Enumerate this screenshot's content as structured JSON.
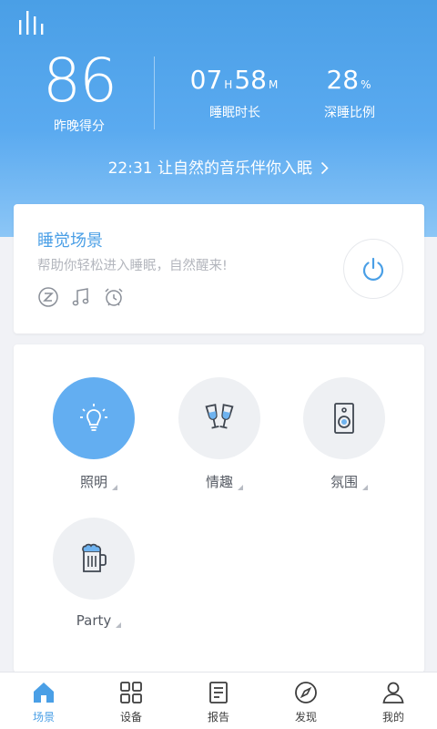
{
  "header": {
    "score_value": "86",
    "score_label": "昨晚得分",
    "duration_hours": "07",
    "duration_hours_unit": "H",
    "duration_minutes": "58",
    "duration_minutes_unit": "M",
    "duration_label": "睡眠时长",
    "deep_value": "28",
    "deep_unit": "%",
    "deep_label": "深睡比例",
    "sleep_time": "22:31",
    "sleep_prompt": "让自然的音乐伴你入眠"
  },
  "scene": {
    "title": "睡觉场景",
    "description": "帮助你轻松进入睡眠，自然醒来!",
    "icons": [
      "zzz-icon",
      "music-note-icon",
      "alarm-clock-icon"
    ]
  },
  "modes": [
    {
      "label": "照明",
      "icon": "lightbulb-icon",
      "active": true
    },
    {
      "label": "情趣",
      "icon": "wine-glasses-icon",
      "active": false
    },
    {
      "label": "氛围",
      "icon": "speaker-icon",
      "active": false
    },
    {
      "label": "Party",
      "icon": "beer-mug-icon",
      "active": false
    }
  ],
  "tabs": [
    {
      "label": "场景",
      "icon": "home-icon",
      "active": true
    },
    {
      "label": "设备",
      "icon": "grid-icon",
      "active": false
    },
    {
      "label": "报告",
      "icon": "report-icon",
      "active": false
    },
    {
      "label": "发现",
      "icon": "compass-icon",
      "active": false
    },
    {
      "label": "我的",
      "icon": "user-icon",
      "active": false
    }
  ],
  "colors": {
    "accent": "#4a9fe6",
    "active_circle": "#63aef1",
    "inactive_circle": "#eef0f3",
    "tab_text": "#3d3d3d"
  }
}
